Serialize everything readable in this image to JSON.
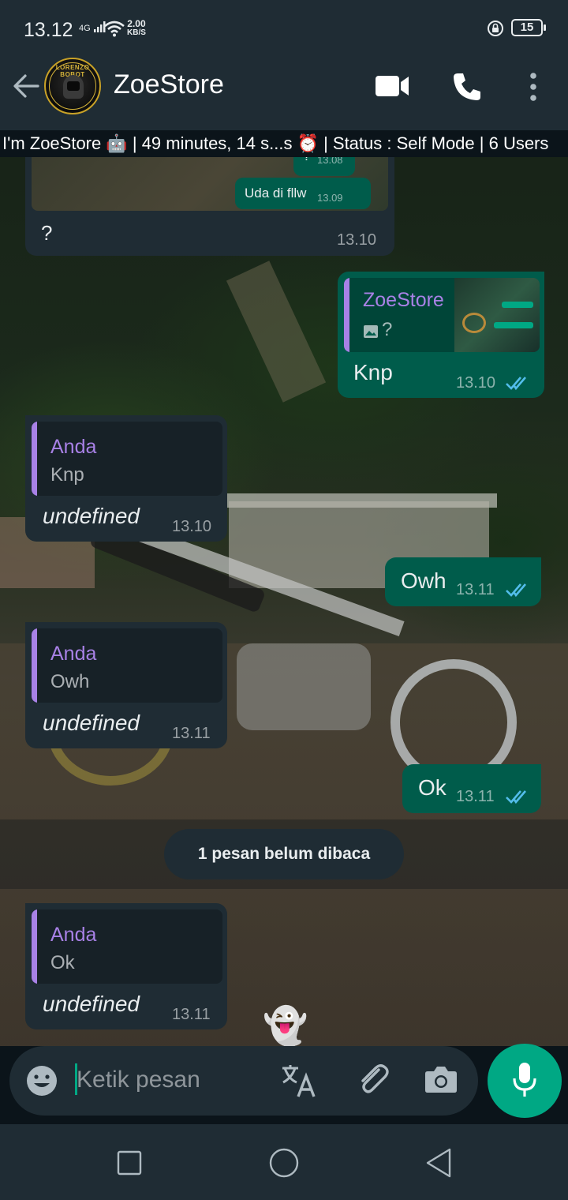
{
  "status_bar": {
    "time": "13.12",
    "network": "4G",
    "speed_value": "2.00",
    "speed_unit": "KB/S",
    "battery": "15"
  },
  "header": {
    "contact_name": "ZoeStore",
    "avatar_text": "LORENZO BOBOT",
    "icons": [
      "back-arrow-icon",
      "video-call-icon",
      "voice-call-icon",
      "more-options-icon"
    ]
  },
  "banner": {
    "text": "I'm ZoeStore 🤖 | 49 minutes, 14 s...s ⏰ | Status : Self Mode | 6 Users"
  },
  "screenshot_bubble": {
    "mini_messages": [
      {
        "text": "?",
        "time": "13.08"
      },
      {
        "text": "Uda di fllw",
        "time": "13.09"
      }
    ],
    "caption": "?",
    "time": "13.10"
  },
  "messages": [
    {
      "direction": "out",
      "quote_name": "ZoeStore",
      "quote_text": "?",
      "text": "Knp",
      "time": "13.10"
    },
    {
      "direction": "in",
      "quote_name": "Anda",
      "quote_text": "Knp",
      "text": "undefined",
      "time": "13.10"
    },
    {
      "direction": "out",
      "text": "Owh",
      "time": "13.11"
    },
    {
      "direction": "in",
      "quote_name": "Anda",
      "quote_text": "Owh",
      "text": "undefined",
      "time": "13.11"
    },
    {
      "direction": "out",
      "text": "Ok",
      "time": "13.11"
    },
    {
      "direction": "in",
      "quote_name": "Anda",
      "quote_text": "Ok",
      "text": "undefined",
      "time": "13.11"
    }
  ],
  "unread_label": "1 pesan belum dibaca",
  "ghost": "👻",
  "input": {
    "placeholder": "Ketik pesan"
  },
  "colors": {
    "incoming": "#1f2c34",
    "outgoing": "#005c4b",
    "accent": "#00a884",
    "quote_name": "#a881e6",
    "ticks": "#53bdeb"
  }
}
